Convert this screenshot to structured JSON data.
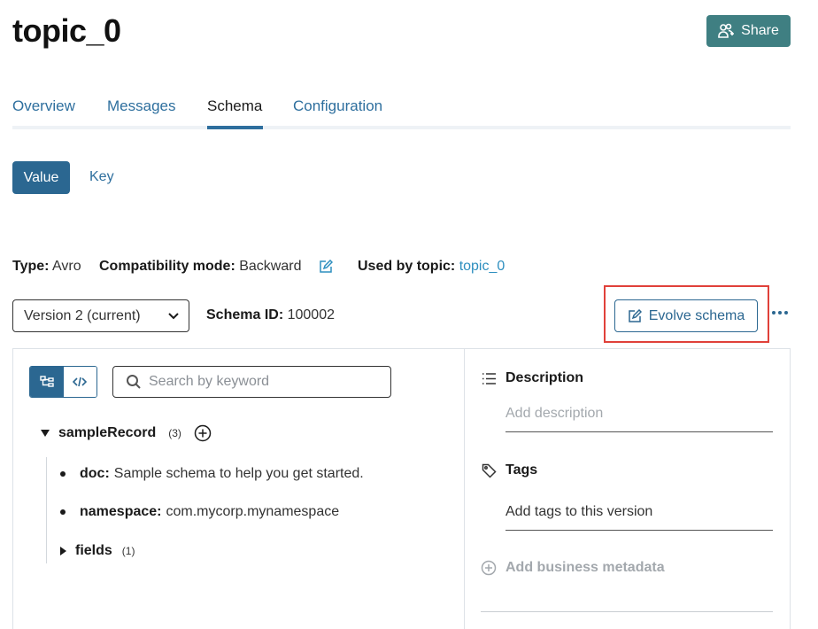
{
  "page": {
    "title": "topic_0"
  },
  "share_label": "Share",
  "tabs": [
    {
      "label": "Overview"
    },
    {
      "label": "Messages"
    },
    {
      "label": "Schema"
    },
    {
      "label": "Configuration"
    }
  ],
  "active_tab": "Schema",
  "subject_tabs": {
    "value": "Value",
    "key": "Key"
  },
  "schema_meta": {
    "type_label": "Type:",
    "type_value": "Avro",
    "compat_label": "Compatibility mode:",
    "compat_value": "Backward",
    "used_label": "Used by topic:",
    "used_value": "topic_0"
  },
  "version_select": {
    "value": "Version 2 (current)"
  },
  "schema_id": {
    "label": "Schema ID:",
    "value": "100002"
  },
  "evolve_label": "Evolve schema",
  "search": {
    "placeholder": "Search by keyword"
  },
  "tree": {
    "root": {
      "name": "sampleRecord",
      "count": "(3)"
    },
    "children": [
      {
        "key": "doc:",
        "value": "Sample schema to help you get started."
      },
      {
        "key": "namespace:",
        "value": "com.mycorp.mynamespace"
      }
    ],
    "fields": {
      "key": "fields",
      "count": "(1)"
    }
  },
  "sidebar": {
    "description_heading": "Description",
    "description_placeholder": "Add description",
    "tags_heading": "Tags",
    "tags_value": "Add tags to this version",
    "metadata_label": "Add business metadata"
  },
  "colors": {
    "primary": "#2b6791",
    "share_bg": "#3f7f82",
    "link": "#2e8fbf",
    "highlight": "#e0413a"
  }
}
